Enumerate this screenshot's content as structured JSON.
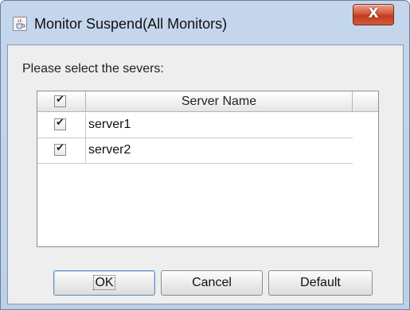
{
  "window": {
    "title": "Monitor Suspend(All Monitors)",
    "icon": "java-cup-icon",
    "close_label": "X"
  },
  "prompt": "Please select the severs:",
  "table": {
    "columns": [
      "",
      "Server Name"
    ],
    "header_checked": true,
    "rows": [
      {
        "checked": true,
        "name": "server1"
      },
      {
        "checked": true,
        "name": "server2"
      }
    ]
  },
  "buttons": {
    "ok": "OK",
    "cancel": "Cancel",
    "default": "Default"
  },
  "colors": {
    "titlebar": "#c5d6ec",
    "close_button": "#c33a1f",
    "client_bg": "#eeeeee"
  }
}
